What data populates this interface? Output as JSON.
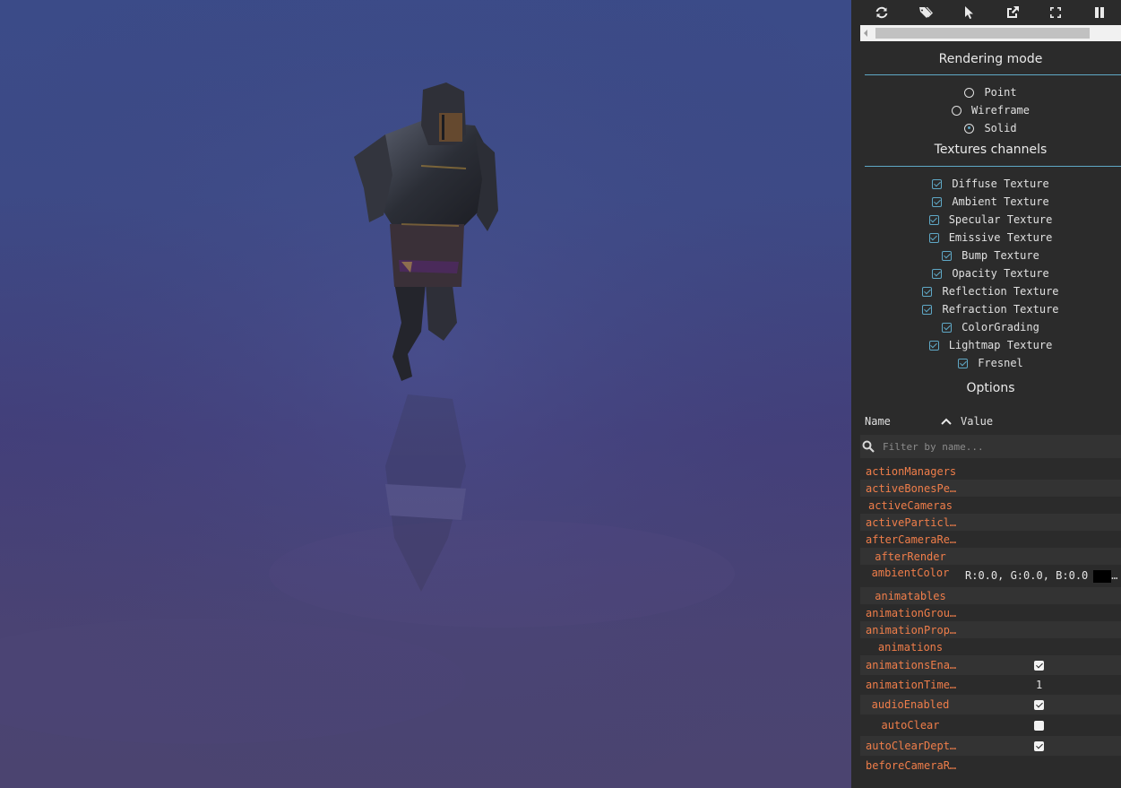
{
  "toolbar": {
    "icons": [
      "refresh-icon",
      "tags-icon",
      "pointer-icon",
      "external-link-icon",
      "fullscreen-icon",
      "pause-icon"
    ]
  },
  "rendering_mode": {
    "title": "Rendering mode",
    "options": [
      {
        "label": "Point",
        "checked": false
      },
      {
        "label": "Wireframe",
        "checked": false
      },
      {
        "label": "Solid",
        "checked": true
      }
    ]
  },
  "textures": {
    "title": "Textures channels",
    "items": [
      {
        "label": "Diffuse Texture",
        "checked": true
      },
      {
        "label": "Ambient Texture",
        "checked": true
      },
      {
        "label": "Specular Texture",
        "checked": true
      },
      {
        "label": "Emissive Texture",
        "checked": true
      },
      {
        "label": "Bump Texture",
        "checked": true
      },
      {
        "label": "Opacity Texture",
        "checked": true
      },
      {
        "label": "Reflection Texture",
        "checked": true
      },
      {
        "label": "Refraction Texture",
        "checked": true
      },
      {
        "label": "ColorGrading",
        "checked": true
      },
      {
        "label": "Lightmap Texture",
        "checked": true
      },
      {
        "label": "Fresnel",
        "checked": true
      }
    ]
  },
  "options": {
    "title": "Options",
    "name_header": "Name",
    "value_header": "Value",
    "filter_placeholder": "Filter by name...",
    "properties": [
      {
        "name": "actionManagers"
      },
      {
        "name": "activeBonesPe…"
      },
      {
        "name": "activeCameras"
      },
      {
        "name": "activeParticl…"
      },
      {
        "name": "afterCameraRe…"
      },
      {
        "name": "afterRender"
      },
      {
        "name": "ambientColor",
        "value": "R:0.0, G:0.0, B:0.0",
        "swatch": "#000000"
      },
      {
        "name": "animatables"
      },
      {
        "name": "animationGrou…"
      },
      {
        "name": "animationProp…"
      },
      {
        "name": "animations"
      },
      {
        "name": "animationsEna…",
        "check": true
      },
      {
        "name": "animationTime…",
        "value": "1"
      },
      {
        "name": "audioEnabled",
        "check": true
      },
      {
        "name": "autoClear",
        "check": false
      },
      {
        "name": "autoClearDept…",
        "check": true
      },
      {
        "name": "beforeCameraR…"
      }
    ]
  },
  "colors": {
    "accent": "#5fa8c6",
    "property_name": "#f07e4a",
    "panel_bg": "#2b2b2b",
    "scene_top": "#3b4b88",
    "scene_bottom": "#4b4470"
  }
}
